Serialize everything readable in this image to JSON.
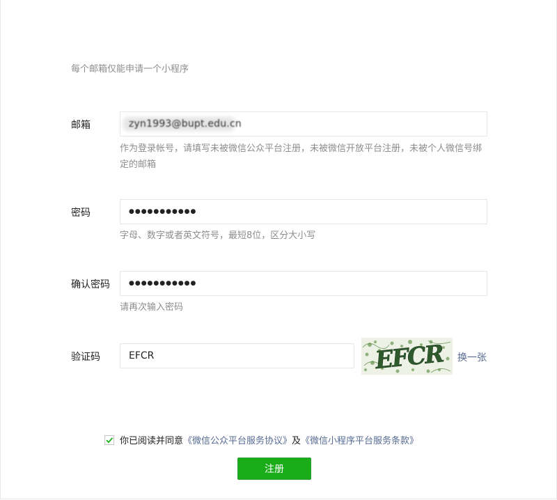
{
  "notice": "每个邮箱仅能申请一个小程序",
  "email": {
    "label": "邮箱",
    "value": "zyn1993@bupt.edu.cn",
    "tip": "作为登录帐号，请填写未被微信公众平台注册，未被微信开放平台注册，未被个人微信号绑定的邮箱"
  },
  "password": {
    "label": "密码",
    "value": "●●●●●●●●●●●",
    "tip": "字母、数字或者英文符号，最短8位，区分大小写"
  },
  "confirm": {
    "label": "确认密码",
    "value": "●●●●●●●●●●●",
    "tip": "请再次输入密码"
  },
  "captcha": {
    "label": "验证码",
    "value": "EFCR",
    "image_text": "EFCR",
    "refresh": "换一张"
  },
  "agreement": {
    "checked": true,
    "prefix": "你已阅读并同意",
    "link1": "《微信公众平台服务协议》",
    "middle": "及",
    "link2": "《微信小程序平台服务条款》"
  },
  "submit_label": "注册",
  "colors": {
    "accent_green": "#1aad19",
    "link_blue": "#576b95",
    "tip_gray": "#8d8d8d",
    "border": "#e7e7eb"
  }
}
